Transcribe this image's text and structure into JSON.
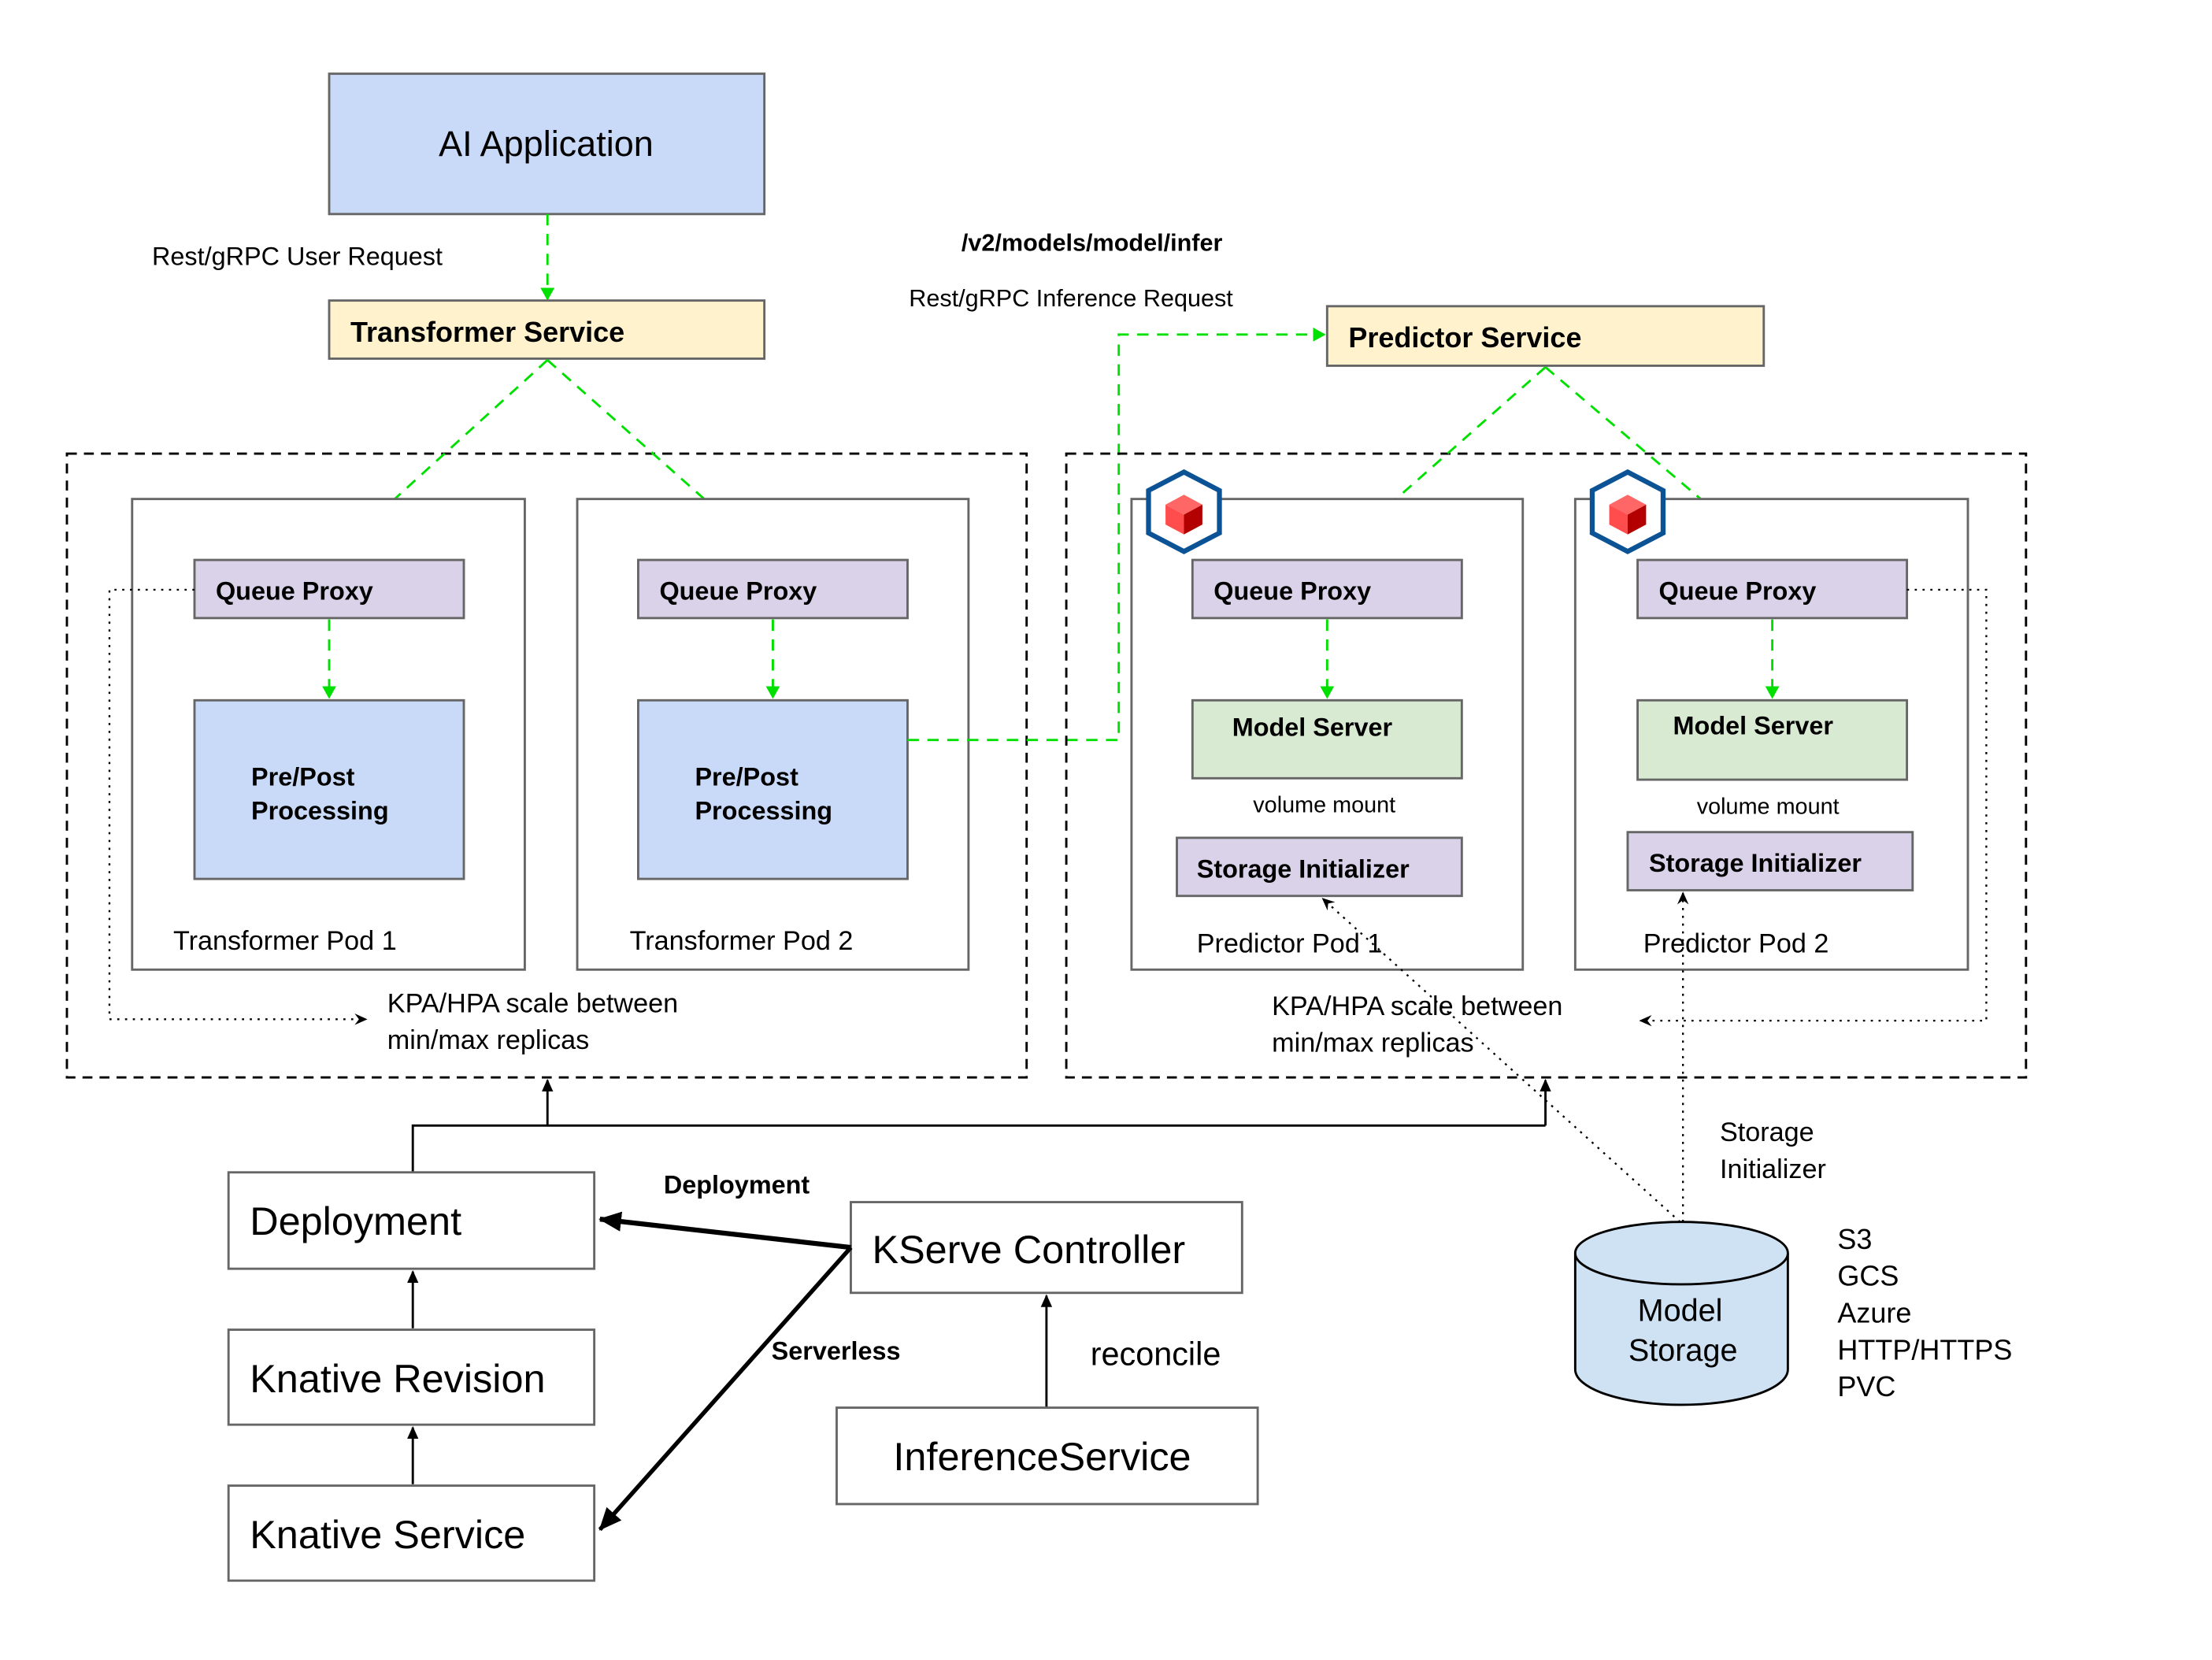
{
  "colors": {
    "app_fill": "#c9daf8",
    "service_fill": "#fff2cc",
    "queue_fill": "#d9d2e9",
    "model_server_fill": "#d9ead3",
    "processing_fill": "#c9daf8",
    "storage_fill": "#cfe2f3",
    "flow_arrow": "#00e000",
    "kserve_icon_hex": "#0b5394",
    "kserve_icon_cube": "#ff4d4d"
  },
  "top": {
    "app_label": "AI Application",
    "user_request_label": "Rest/gRPC User Request",
    "endpoint_label": "/v2/models/model/infer",
    "inference_request_label": "Rest/gRPC Inference Request",
    "transformer_service_label": "Transformer Service",
    "predictor_service_label": "Predictor Service"
  },
  "transformer_group": {
    "pods": [
      {
        "label": "Transformer Pod 1",
        "queue_proxy": "Queue Proxy",
        "processing_line1": "Pre/Post",
        "processing_line2": "Processing"
      },
      {
        "label": "Transformer Pod 2",
        "queue_proxy": "Queue Proxy",
        "processing_line1": "Pre/Post",
        "processing_line2": "Processing"
      }
    ],
    "scale_line1": "KPA/HPA scale between",
    "scale_line2": "min/max replicas"
  },
  "predictor_group": {
    "pods": [
      {
        "label": "Predictor Pod 1",
        "queue_proxy": "Queue Proxy",
        "model_server": "Model Server",
        "volume_mount": "volume mount",
        "storage_initializer": "Storage Initializer"
      },
      {
        "label": "Predictor Pod 2",
        "queue_proxy": "Queue Proxy",
        "model_server": "Model Server",
        "volume_mount": "volume mount",
        "storage_initializer": "Storage Initializer"
      }
    ],
    "scale_line1": "KPA/HPA scale between",
    "scale_line2": "min/max replicas"
  },
  "control": {
    "deployment": "Deployment",
    "knative_revision": "Knative Revision",
    "knative_service": "Knative Service",
    "kserve_controller": "KServe Controller",
    "inference_service": "InferenceService",
    "deployment_edge_label": "Deployment",
    "serverless_edge_label": "Serverless",
    "reconcile_label": "reconcile"
  },
  "storage": {
    "edge_line1": "Storage",
    "edge_line2": "Initializer",
    "cylinder_line1": "Model",
    "cylinder_line2": "Storage",
    "backends": [
      "S3",
      "GCS",
      "Azure",
      "HTTP/HTTPS",
      "PVC"
    ]
  }
}
